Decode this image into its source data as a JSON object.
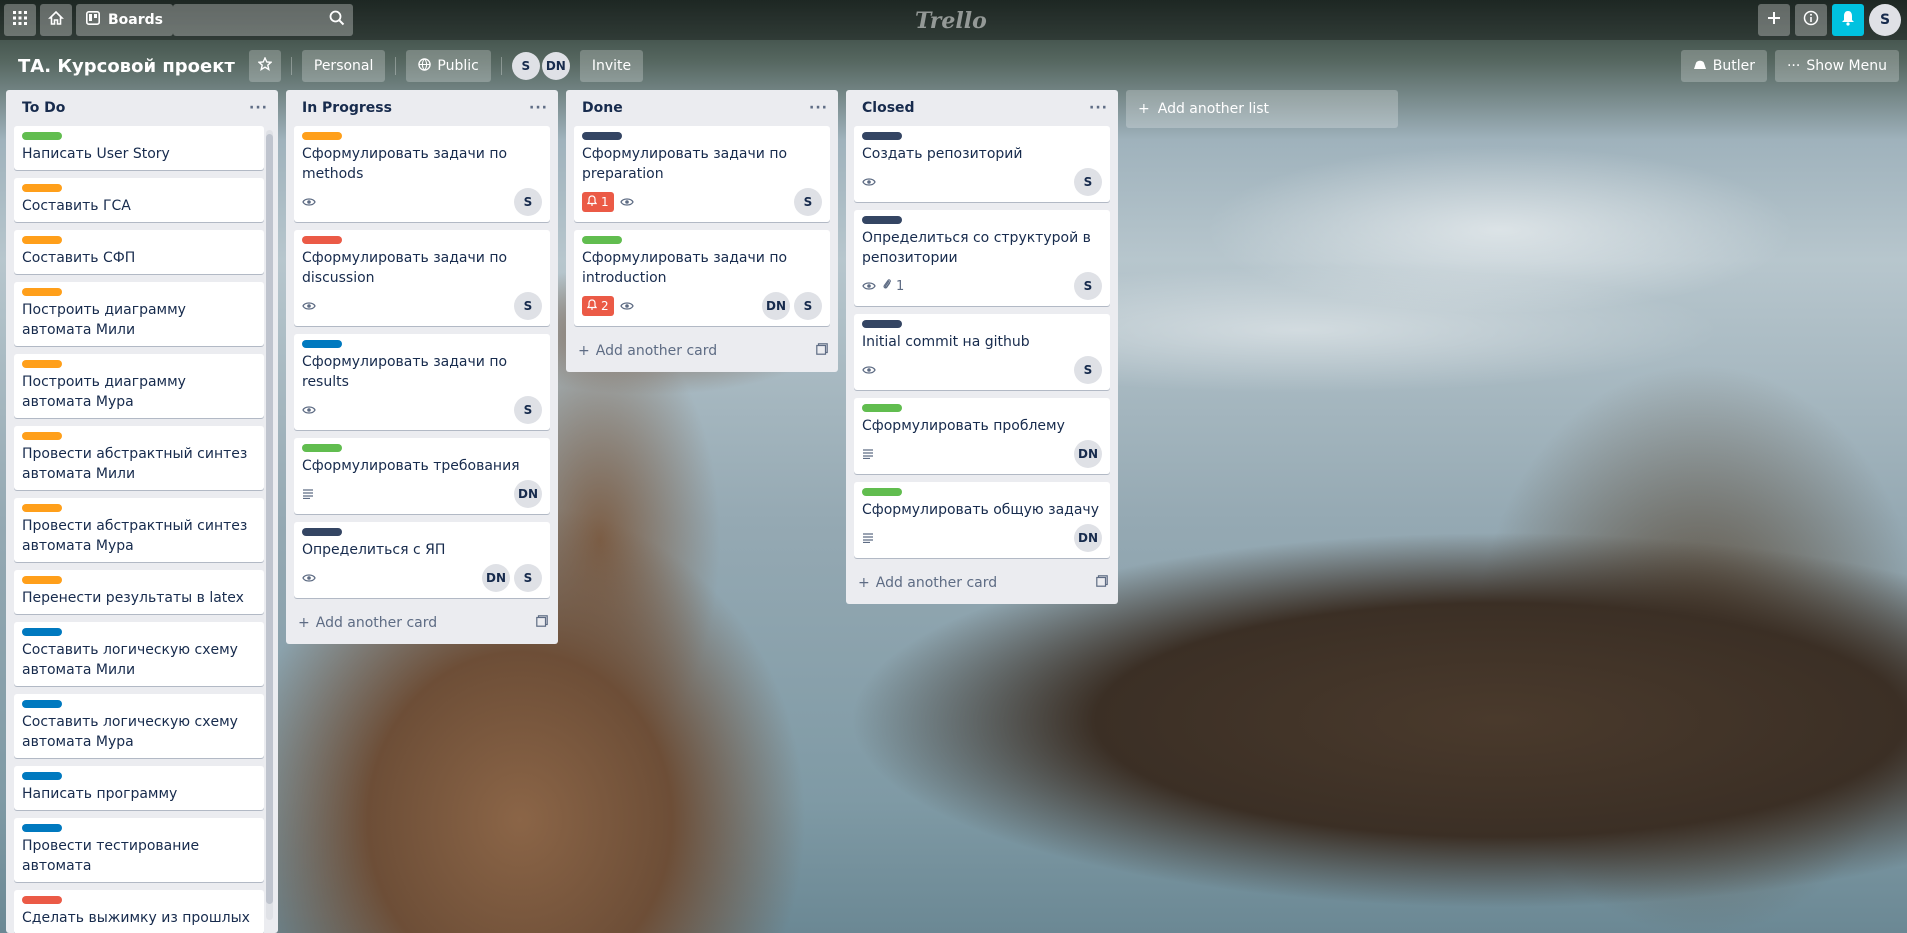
{
  "topbar": {
    "boards_label": "Boards",
    "logo": "Trello",
    "user_initial": "S",
    "icons": [
      "apps-icon",
      "home-icon",
      "board-icon",
      "search-icon",
      "plus-icon",
      "info-icon",
      "bell-icon"
    ]
  },
  "board": {
    "title": "ТА. Курсовой проект",
    "team_label": "Personal",
    "visibility_label": "Public",
    "members": [
      "S",
      "DN"
    ],
    "invite_label": "Invite",
    "butler_label": "Butler",
    "show_menu_label": "Show Menu"
  },
  "lists": [
    {
      "title": "To Do",
      "cards": [
        {
          "label": "green",
          "title": "Написать User Story"
        },
        {
          "label": "orange",
          "title": "Составить ГСА"
        },
        {
          "label": "orange",
          "title": "Составить СФП"
        },
        {
          "label": "orange",
          "title": "Построить диаграмму автомата Мили"
        },
        {
          "label": "orange",
          "title": "Построить диаграмму автомата Мура"
        },
        {
          "label": "orange",
          "title": "Провести абстрактный синтез автомата Мили"
        },
        {
          "label": "orange",
          "title": "Провести абстрактный синтез автомата Мура"
        },
        {
          "label": "orange",
          "title": "Перенести результаты в latex"
        },
        {
          "label": "blue",
          "title": "Составить логическую схему автомата Мили"
        },
        {
          "label": "blue",
          "title": "Составить логическую схему автомата Мура"
        },
        {
          "label": "blue",
          "title": "Написать программу"
        },
        {
          "label": "blue",
          "title": "Провести тестирование автомата"
        },
        {
          "label": "red",
          "title": "Сделать выжимку из прошлых"
        }
      ]
    },
    {
      "title": "In Progress",
      "add_card_label": "Add another card",
      "cards": [
        {
          "label": "orange",
          "title": "Сформулировать задачи по methods",
          "members": [
            "S"
          ]
        },
        {
          "label": "red",
          "title": "Сформулировать задачи по discussion",
          "members": [
            "S"
          ]
        },
        {
          "label": "blue",
          "title": "Сформулировать задачи по results",
          "members": [
            "S"
          ]
        },
        {
          "label": "green",
          "title": "Сформулировать требования",
          "members": [
            "DN"
          ]
        },
        {
          "label": "navy",
          "title": "Определиться с ЯП",
          "members": [
            "DN",
            "S"
          ]
        }
      ]
    },
    {
      "title": "Done",
      "add_card_label": "Add another card",
      "cards": [
        {
          "label": "navy",
          "title": "Сформулировать задачи по preparation",
          "due": "1",
          "members": [
            "S"
          ]
        },
        {
          "label": "green",
          "title": "Сформулировать задачи по introduction",
          "due": "2",
          "members": [
            "DN",
            "S"
          ]
        }
      ]
    },
    {
      "title": "Closed",
      "add_card_label": "Add another card",
      "cards": [
        {
          "label": "navy",
          "title": "Создать репозиторий",
          "members": [
            "S"
          ]
        },
        {
          "label": "navy",
          "title": "Определиться со структурой в репозитории",
          "attachments": "1",
          "members": [
            "S"
          ]
        },
        {
          "label": "navy",
          "title": "Initial commit на github",
          "members": [
            "S"
          ]
        },
        {
          "label": "green",
          "title": "Сформулировать проблему",
          "members": [
            "DN"
          ]
        },
        {
          "label": "green",
          "title": "Сформулировать общую задачу",
          "members": [
            "DN"
          ]
        }
      ]
    }
  ],
  "add_list_label": "Add another list",
  "colors": {
    "green": "#61bd4f",
    "orange": "#ff9f1a",
    "red": "#eb5a46",
    "blue": "#0079bf",
    "navy": "#344563",
    "notification": "#00c2e0"
  }
}
